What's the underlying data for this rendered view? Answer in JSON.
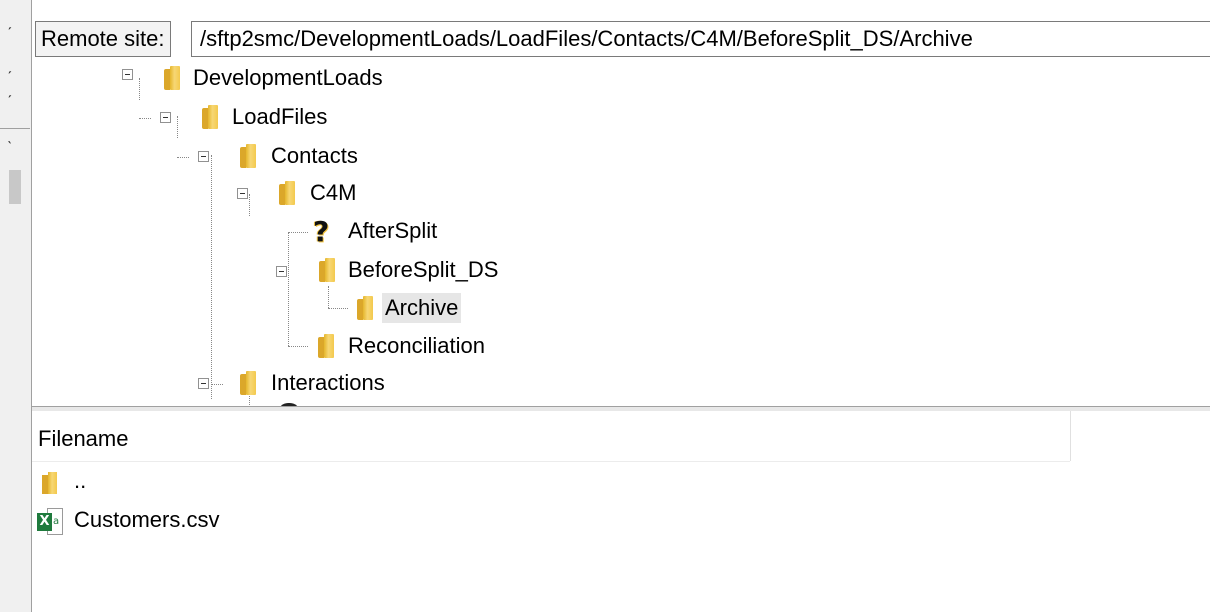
{
  "remote_site": {
    "label": "Remote site:",
    "path": "/sftp2smc/DevelopmentLoads/LoadFiles/Contacts/C4M/BeforeSplit_DS/Archive"
  },
  "tree": {
    "nodes": [
      {
        "label": "DevelopmentLoads",
        "icon": "folder-icon",
        "expanded": true
      },
      {
        "label": "LoadFiles",
        "icon": "folder-icon",
        "expanded": true
      },
      {
        "label": "Contacts",
        "icon": "folder-icon",
        "expanded": true
      },
      {
        "label": "C4M",
        "icon": "folder-icon",
        "expanded": true
      },
      {
        "label": "AfterSplit",
        "icon": "unknown-icon",
        "expanded": false
      },
      {
        "label": "BeforeSplit_DS",
        "icon": "folder-icon",
        "expanded": true
      },
      {
        "label": "Archive",
        "icon": "folder-icon",
        "selected": true
      },
      {
        "label": "Reconciliation",
        "icon": "folder-icon",
        "expanded": false
      },
      {
        "label": "Interactions",
        "icon": "folder-icon",
        "expanded": true
      }
    ]
  },
  "filelist": {
    "column_header": "Filename",
    "files": [
      {
        "name": "..",
        "icon": "folder-icon"
      },
      {
        "name": "Customers.csv",
        "icon": "excel-csv-icon"
      }
    ]
  },
  "colors": {
    "folder": "#f3c94d",
    "selection": "#e6e6e6",
    "excel_green": "#1f7a3d"
  }
}
